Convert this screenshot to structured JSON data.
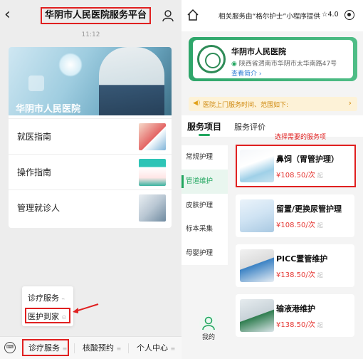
{
  "left": {
    "header": {
      "title": "华阴市人民医院服务平台",
      "time": "11:12"
    },
    "banner": {
      "label": "华阴市人民医院"
    },
    "menu": [
      {
        "label": "就医指南"
      },
      {
        "label": "操作指南"
      },
      {
        "label": "管理就诊人"
      }
    ],
    "popup": [
      {
        "label": "诊疗服务"
      },
      {
        "label": "医护到家"
      }
    ],
    "bottom_tabs": [
      {
        "label": "诊疗服务"
      },
      {
        "label": "核酸预约"
      },
      {
        "label": "个人中心"
      }
    ]
  },
  "right": {
    "header": {
      "provider": "相关服务由“格尔护士”小程序提供",
      "rating": "☆4.0"
    },
    "hospital": {
      "name": "华阴市人民医院",
      "address": "陕西省渭南市华阴市太华南路47号",
      "intro": "查看简介 ›"
    },
    "notice": {
      "text": "医院上门服务时间、范围如下:"
    },
    "tabs": {
      "services": "服务项目",
      "reviews": "服务评价"
    },
    "hint": "选择需要的服务项",
    "categories": [
      {
        "label": "常规护理"
      },
      {
        "label": "管道维护"
      },
      {
        "label": "皮肤护理"
      },
      {
        "label": "标本采集"
      },
      {
        "label": "母婴护理"
      }
    ],
    "services": [
      {
        "name": "鼻饲（胃管护理）",
        "price": "¥108.50/次",
        "unit": "起"
      },
      {
        "name": "留置/更换尿管护理",
        "price": "¥108.50/次",
        "unit": "起"
      },
      {
        "name": "PICC置管维护",
        "price": "¥138.50/次",
        "unit": "起"
      },
      {
        "name": "输液港维护",
        "price": "¥138.50/次",
        "unit": "起"
      }
    ],
    "mine_label": "我的"
  }
}
